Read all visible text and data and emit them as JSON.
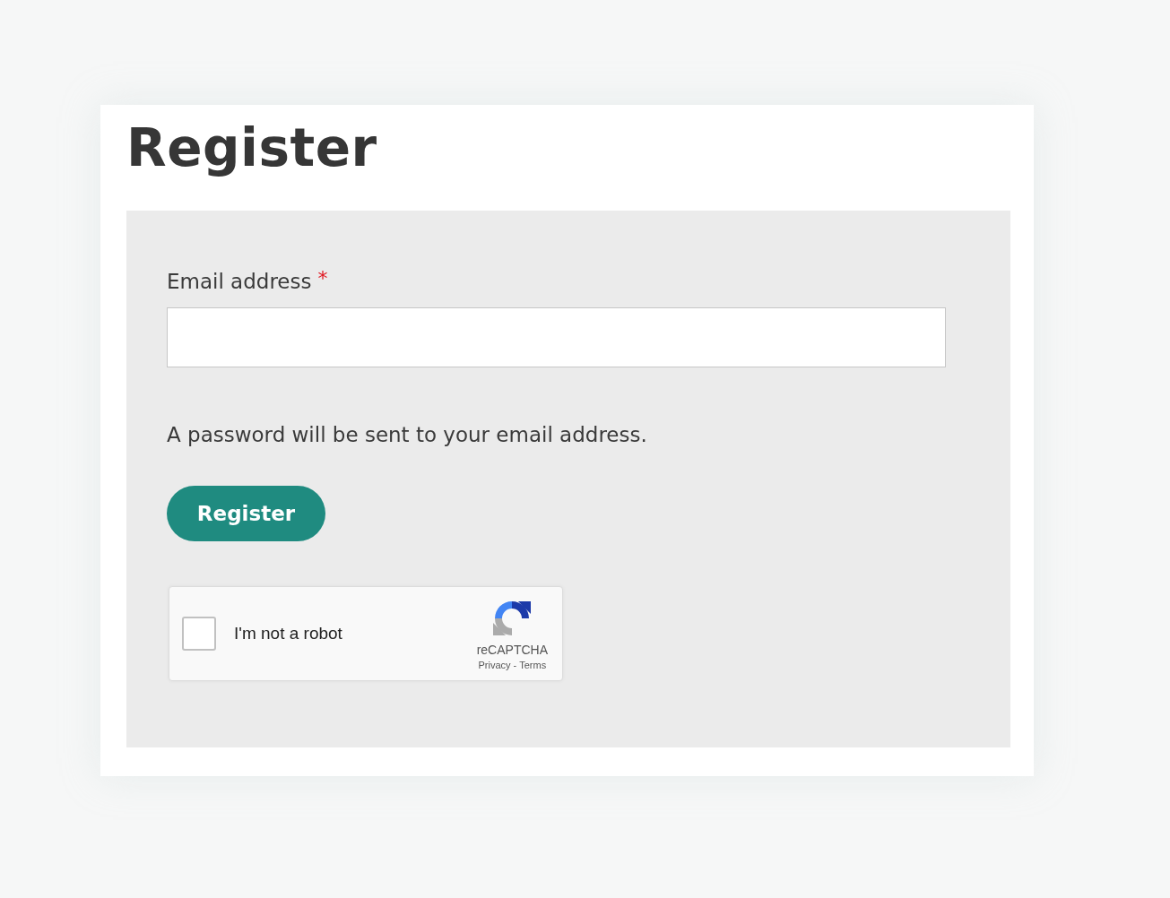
{
  "title": "Register",
  "form": {
    "email_label": "Email address",
    "required_mark": "*",
    "note": "A password will be sent to your email address.",
    "submit": "Register"
  },
  "captcha": {
    "label": "I'm not a robot",
    "checked": false,
    "brand": "reCAPTCHA",
    "links": [
      "Privacy",
      "Terms"
    ],
    "separator": "-"
  }
}
